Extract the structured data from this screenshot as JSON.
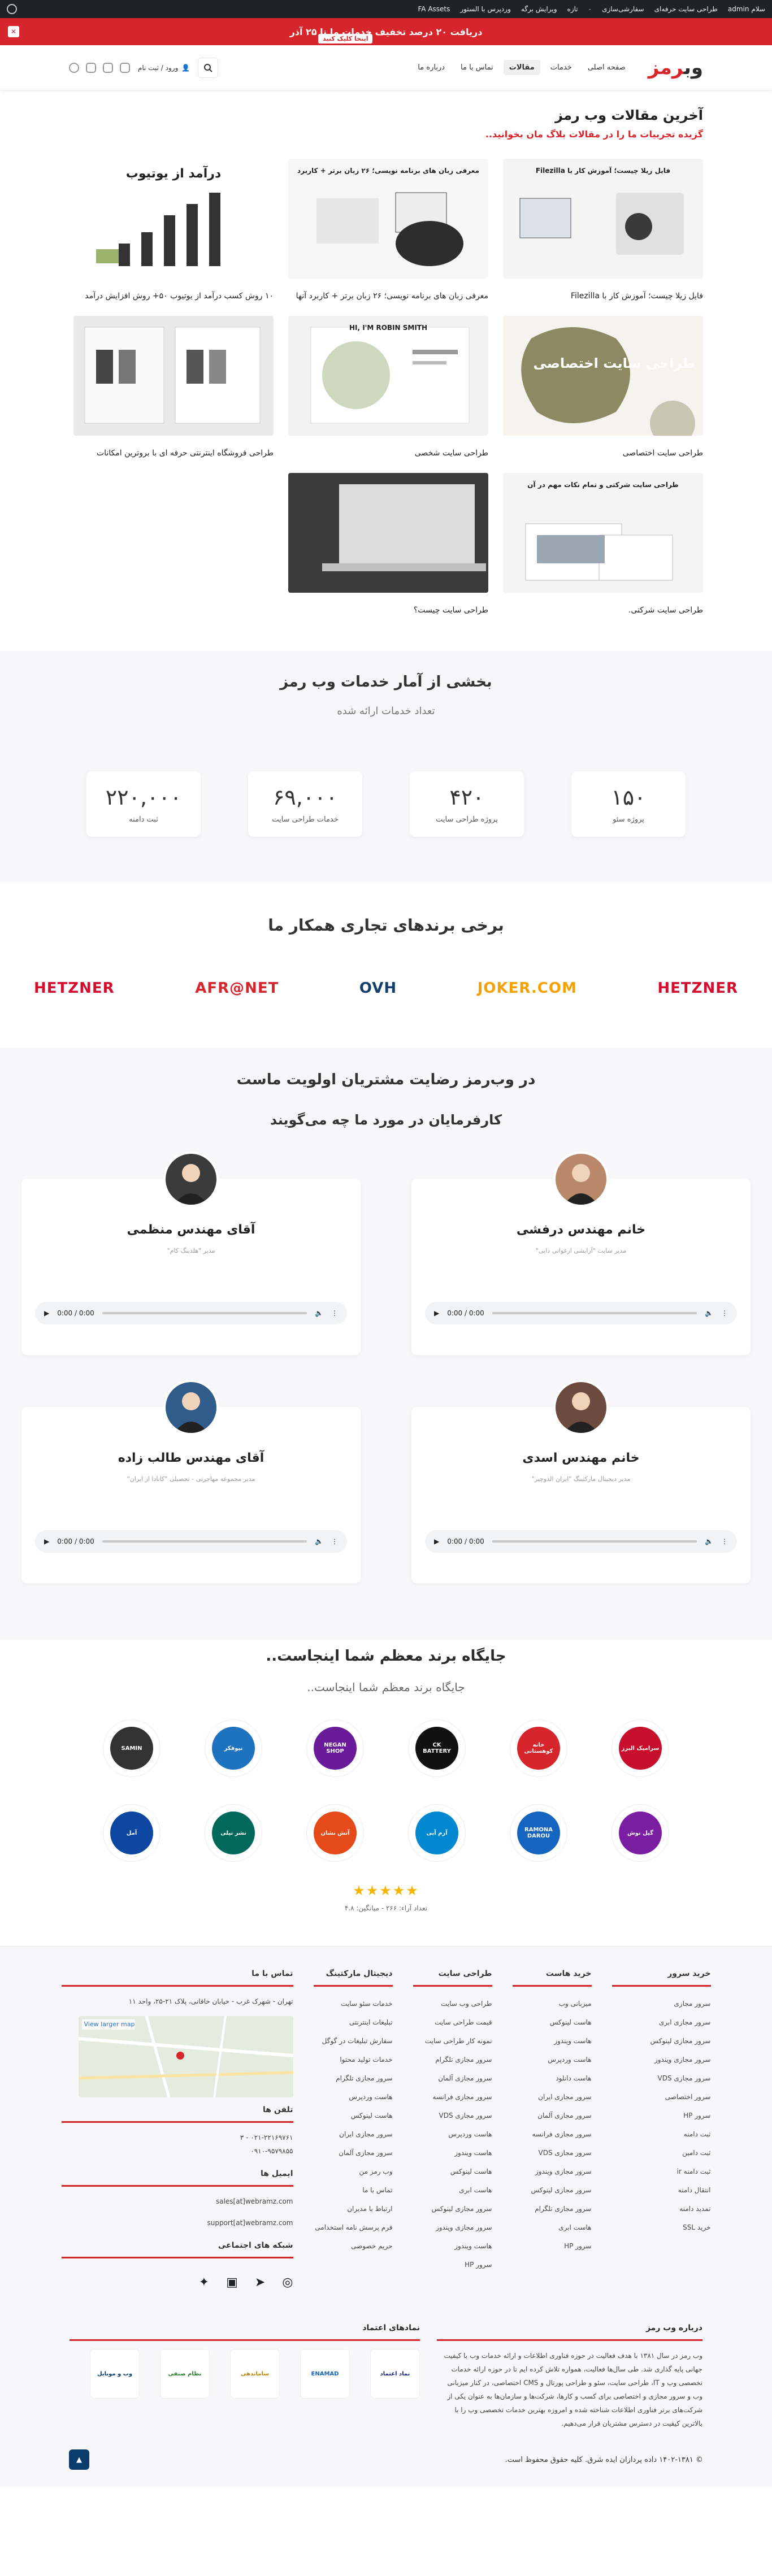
{
  "adminbar": {
    "right_items": [
      "سلام admin",
      "طراحی سایت حرفه‌ای",
      "سفارشی‌سازی",
      "۰",
      "تازه",
      "ویرایش برگه",
      "وردپرس با الستور",
      "FA Assets"
    ]
  },
  "promo": {
    "text": "دریافت ۲۰ درصد تخفیف خدمات ما تا ۲۵ آذر",
    "cta": "اینجا کلیک کنید",
    "close": "✕"
  },
  "header": {
    "logo_main": "وب",
    "logo_accent": "رمز",
    "nav": [
      "صفحه اصلی",
      "خدمات",
      "مقالات",
      "تماس با ما",
      "درباره ما"
    ],
    "login": "ورود / ثبت نام"
  },
  "articles": {
    "title": "آخرین مقالات وب رمز",
    "subtitle": "گزیده تجربیات ما را در مقالات بلاگ مان بخوانید..",
    "items": [
      {
        "title": "فایل زیلا چیست؛ آموزش کار با Filezilla",
        "thumb_text": "فایل زیلا چیست؛ آموزش کار با Filezilla"
      },
      {
        "title": "معرفی زبان های برنامه نویسی؛ ۲۶ زبان برتر + کاربرد آنها",
        "thumb_text": "معرفی زبان های برنامه نویسی؛ ۲۶ زبان برتر + کاربرد"
      },
      {
        "title": "۱۰ روش کسب درآمد از یوتیوب ۵۰+ روش افزایش درآمد",
        "thumb_text": "درآمد از یوتیوب"
      },
      {
        "title": "طراحی سایت اختصاصی",
        "thumb_text": "طراحی سایت اختصاصی"
      },
      {
        "title": "طراحی سایت شخصی",
        "thumb_text": "HI, I'M ROBIN SMITH"
      },
      {
        "title": "طراحی فروشگاه اینترنتی حرفه ای با بروترین امکانات",
        "thumb_text": ""
      },
      {
        "title": "طراحی سایت شرکتی.",
        "thumb_text": "طراحی سایت شرکتی و تمام نکات مهم در آن"
      },
      {
        "title": "طراحی سایت چیست؟",
        "thumb_text": ""
      }
    ]
  },
  "stats": {
    "title": "بخشی از آمار خدمات وب رمز",
    "subtitle": "تعداد خدمات ارائه شده",
    "items": [
      {
        "value": "۱۵۰",
        "label": "پروژه سئو"
      },
      {
        "value": "۴۲۰",
        "label": "پروژه طراحی سایت"
      },
      {
        "value": "۶۹,۰۰۰",
        "label": "خدمات طراحی سایت"
      },
      {
        "value": "۲۲۰,۰۰۰",
        "label": "ثبت دامنه"
      }
    ]
  },
  "brands": {
    "title": "برخی برندهای تجاری همکار ما",
    "items": [
      {
        "name": "HETZNER",
        "color": "#d50c2d"
      },
      {
        "name": "JOKER.COM",
        "color": "#f5a200"
      },
      {
        "name": "OVH",
        "color": "#123f6d"
      },
      {
        "name": "AFR@NET",
        "color": "#d7262b"
      },
      {
        "name": "HETZNER",
        "color": "#d50c2d"
      }
    ]
  },
  "testimonials": {
    "title": "در وب‌رمز رضایت مشتریان اولویت ماست",
    "subtitle": "کارفرمایان در مورد ما چه می‌گویند",
    "items": [
      {
        "name": "خانم مهندس درفشی",
        "role": "مدیر سایت \"آرایشی ارغوانی دایی\""
      },
      {
        "name": "آقای مهندس منظمی",
        "role": "مدیر \"هلدینگ کام\""
      },
      {
        "name": "خانم مهندس اسدی",
        "role": "مدیر دیجیتال مارکتینگ \"ایران الدوچیر\""
      },
      {
        "name": "آقای مهندس طالب زاده",
        "role": "مدیر مجموعه مهاجرتی - تحصیلی \"کانادا از ایران\""
      }
    ],
    "audio_time": "0:00 / 0:00"
  },
  "place": {
    "title": "جایگاه برند معظم شما اینجاست..",
    "subtitle": "جایگاه برند معظم شما اینجاست..",
    "logos": [
      {
        "text": "سرامیک البرز",
        "color": "#c8102e"
      },
      {
        "text": "خانه کوهستانی",
        "color": "#d7262b"
      },
      {
        "text": "CK BATTERY",
        "color": "#111111"
      },
      {
        "text": "NEGAN SHOP",
        "color": "#6a1b9a"
      },
      {
        "text": "نیوفکر",
        "color": "#1e73be"
      },
      {
        "text": "SAMIN",
        "color": "#333333"
      },
      {
        "text": "گیل نوش",
        "color": "#7b1fa2"
      },
      {
        "text": "RAMONA DAROU",
        "color": "#1565c0"
      },
      {
        "text": "آرم آبی",
        "color": "#0288d1"
      },
      {
        "text": "آتش نشان",
        "color": "#e64a19"
      },
      {
        "text": "نشر نیلی",
        "color": "#00695c"
      },
      {
        "text": "آمل",
        "color": "#0d47a1"
      }
    ],
    "stars": "★★★★★",
    "rating": "تعداد آراء: ۲۶۶ - میانگین: ۴.۸"
  },
  "footer": {
    "cols": [
      {
        "title": "خرید سرور",
        "items": [
          "سرور مجازی",
          "سرور مجازی ابری",
          "سرور مجازی لینوکس",
          "سرور مجازی ویندوز",
          "سرور مجازی VDS",
          "سرور اختصاصی",
          "سرور HP",
          "ثبت دامنه",
          "ثبت دامین",
          "ثبت دامنه ir",
          "انتقال دامنه",
          "تمدید دامنه",
          "خرید SSL"
        ]
      },
      {
        "title": "خرید هاست",
        "items": [
          "میزبانی وب",
          "هاست لینوکس",
          "هاست ویندوز",
          "هاست وردپرس",
          "هاست دانلود",
          "سرور مجازی ایران",
          "سرور مجازی آلمان",
          "سرور مجازی فرانسه",
          "سرور مجازی VDS",
          "سرور مجازی ویندوز",
          "سرور مجازی لینوکس",
          "سرور مجازی تلگرام",
          "هاست ابری",
          "سرور HP"
        ]
      },
      {
        "title": "طراحی سایت",
        "items": [
          "طراحی وب سایت",
          "قیمت طراحی سایت",
          "نمونه کار طراحی سایت",
          "سرور مجازی تلگرام",
          "سرور مجازی آلمان",
          "سرور مجازی فرانسه",
          "سرور مجازی VDS",
          "هاست وردپرس",
          "هاست ویندوز",
          "هاست لینوکس",
          "هاست ابری",
          "سرور مجازی لینوکس",
          "سرور مجازی ویندوز",
          "هاست ویندوز",
          "سرور HP"
        ]
      },
      {
        "title": "دیجیتال مارکتینگ",
        "items": [
          "خدمات سئو سایت",
          "تبلیغات اینترنتی",
          "سفارش تبلیغات در گوگل",
          "خدمات تولید محتوا",
          "سرور مجازی تلگرام",
          "هاست وردپرس",
          "هاست لینوکس",
          "سرور مجازی ایران",
          "سرور مجازی آلمان",
          "وب رمز من",
          "تماس با ما",
          "ارتباط با مدیران",
          "فرم پرسش نامه استخدامی",
          "حریم خصوصی"
        ]
      }
    ],
    "contact": {
      "title": "تماس با ما",
      "address": "تهران - شهرک غرب - خیابان خاقانی، پلاک ۲۱-۲۵، واحد ۱۱",
      "map_label": "View larger map",
      "phones_title": "تلفن ها",
      "phones": [
        "۰۲۱-۲۲۱۶۹۷۶۱ - ۳",
        "۰۹۱۰-۹۵۷۹۸۵۵"
      ],
      "email_title": "ایمیل ها",
      "emails": [
        "sales[at]webramz.com",
        "support[at]webramz.com"
      ],
      "social_title": "شبکه های اجتماعی"
    },
    "about": {
      "title": "درباره وب رمز",
      "text": "وب رمز در سال ۱۳۸۱ با هدف فعالیت در حوزه فناوری اطلاعات و ارائه خدمات وب با کیفیت جهانی پایه گذاری شد. طی سال‌ها فعالیت، همواره تلاش کرده ایم تا در حوزه ارائه خدمات تخصصی وب و IT، طراحی سایت، سئو و طراحی پورتال و CMS اختصاصی، در کنار میزبانی وب و سرور مجازی و اختصاصی برای کسب و کارها، شرکت‌ها و سازمان‌ها به عنوان یکی از شرکت‌های برتر فناوری اطلاعات شناخته شده و امروزه بهترین خدمات تخصصی وب را با بالاترین کیفیت در دسترس مشتریان قرار می‌دهیم."
    },
    "trust_title": "نمادهای اعتماد",
    "trust": [
      "نماد اعتماد",
      "ENAMAD",
      "ساماندهی",
      "نظام صنفی",
      "وب و موبایل"
    ],
    "copyright": "© ۱۴۰۲-۱۳۸۱ داده پردازان ایده شرق. کلیه حقوق محفوظ است."
  },
  "colors": {
    "accent": "#d7262b",
    "dark": "#1d2327"
  }
}
